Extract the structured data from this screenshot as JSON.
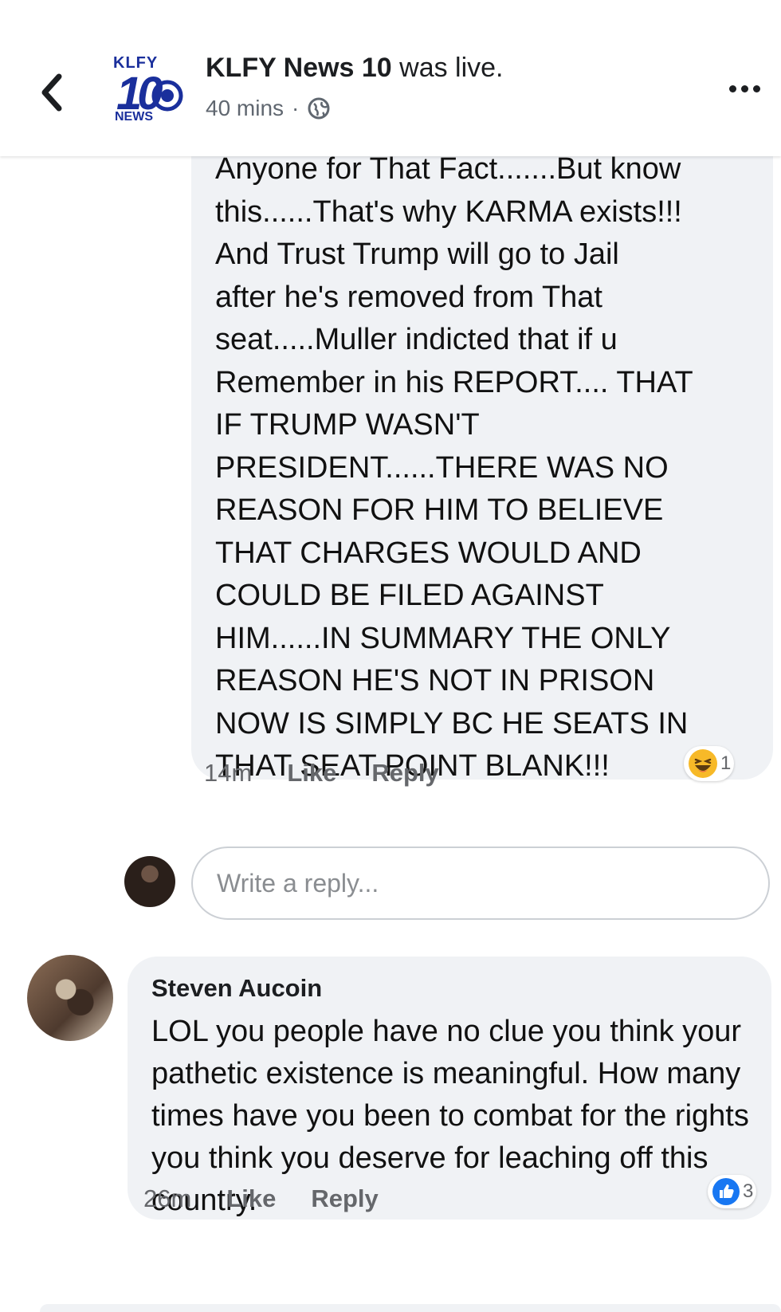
{
  "header": {
    "page_name": "KLFY News 10",
    "action": " was live.",
    "time": "40 mins",
    "separator": "·",
    "logo": {
      "top": "KLFY",
      "number": "10",
      "bottom": "NEWS"
    },
    "icons": {
      "back": "chevron-left-icon",
      "privacy": "globe-icon",
      "more": "more-icon"
    }
  },
  "comment1": {
    "text": "Anyone for That Fact.......But know\nthis......That's why KARMA exists!!!\nAnd Trust Trump will go to Jail\nafter he's removed from That\nseat.....Muller indicted that if u\nRemember in his REPORT.... THAT\nIF TRUMP WASN'T\nPRESIDENT......THERE WAS NO\nREASON FOR HIM TO BELIEVE\nTHAT CHARGES WOULD AND\nCOULD BE FILED AGAINST\nHIM......IN SUMMARY THE ONLY\nREASON HE'S NOT IN PRISON\nNOW IS SIMPLY BC HE SEATS IN\nTHAT SEAT POINT BLANK!!!",
    "time": "14m",
    "like": "Like",
    "reply": "Reply",
    "reaction": {
      "type": "haha-icon",
      "count": "1"
    }
  },
  "reply_box": {
    "placeholder": "Write a reply..."
  },
  "comment2": {
    "author": "Steven Aucoin",
    "text": "LOL you people have no clue you think your pathetic existence is meaningful. How many times have you been to combat for the rights you think you deserve for leaching off this country.",
    "time": "26m",
    "like": "Like",
    "reply": "Reply",
    "reaction": {
      "type": "like-icon",
      "count": "3"
    }
  },
  "colors": {
    "bubble": "#f0f2f5",
    "meta": "#65676b",
    "like_blue": "#1877f2",
    "haha_yellow": "#f7b928",
    "logo_blue": "#1a2f9c"
  }
}
